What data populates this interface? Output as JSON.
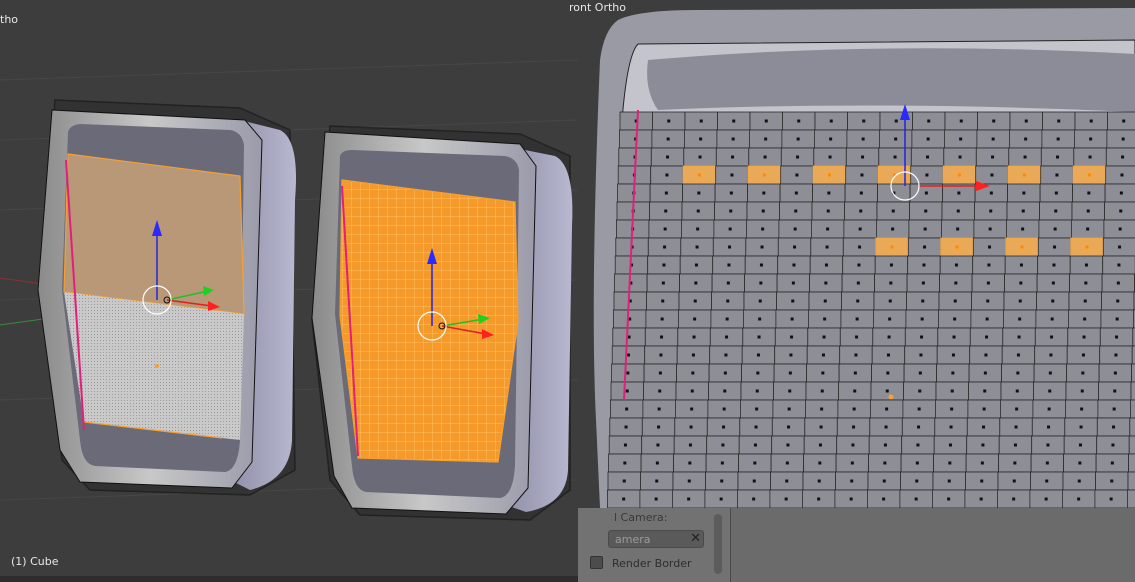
{
  "viewport_left": {
    "view_label": "tho",
    "object_label": "(1) Cube"
  },
  "viewport_right": {
    "view_label": "ront Ortho"
  },
  "properties_panel": {
    "lock_camera_label": "l Camera:",
    "camera_field_value": "amera",
    "render_border_label": "Render Border",
    "clear_icon": "close-icon"
  },
  "colors": {
    "selected": "#f5a030",
    "viewport_bg": "#3d3d3d",
    "mesh_gray": "#9a9a9a",
    "seam": "#e0207a",
    "axis_x": "#e02020",
    "axis_y": "#20c020",
    "axis_z": "#2020e0"
  }
}
